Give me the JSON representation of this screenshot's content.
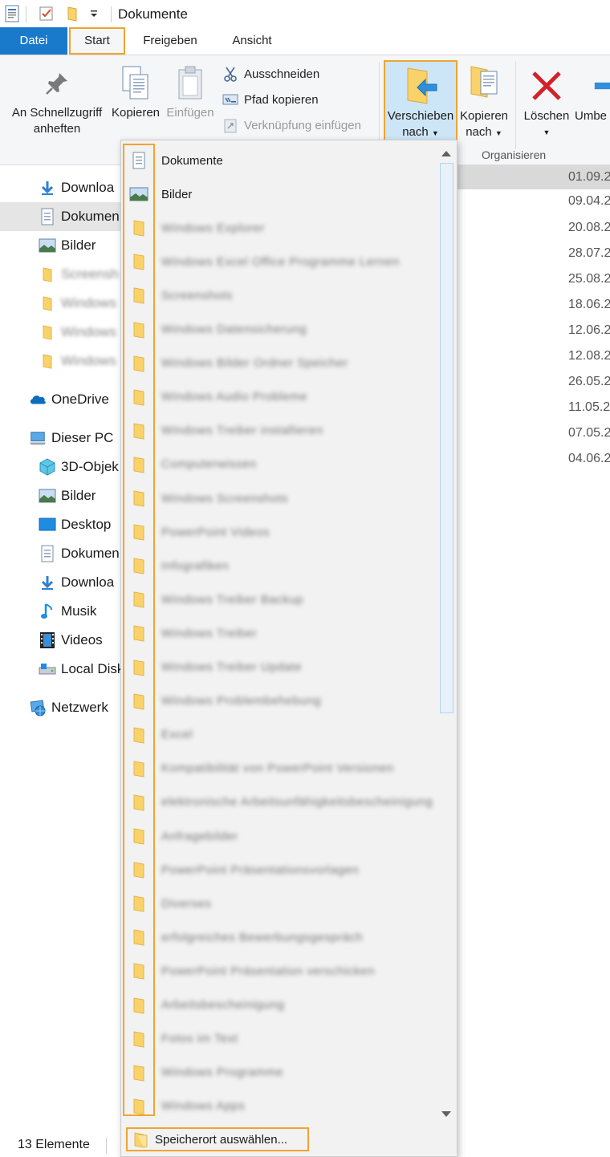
{
  "window": {
    "title": "Dokumente"
  },
  "tabs": {
    "datei": "Datei",
    "start": "Start",
    "freigeben": "Freigeben",
    "ansicht": "Ansicht"
  },
  "ribbon": {
    "pin_line1": "An Schnellzugriff",
    "pin_line2": "anheften",
    "copy": "Kopieren",
    "paste": "Einfügen",
    "cut": "Ausschneiden",
    "copy_path": "Pfad kopieren",
    "paste_shortcut": "Verknüpfung einfügen",
    "move_line1": "Verschieben",
    "move_line2": "nach",
    "copyto_line1": "Kopieren",
    "copyto_line2": "nach",
    "delete": "Löschen",
    "rename": "Umbe",
    "group_organize": "Organisieren"
  },
  "nav": {
    "items": [
      {
        "label": "Downloa"
      },
      {
        "label": "Dokumen"
      },
      {
        "label": "Bilder"
      },
      {
        "label": "Screensh"
      },
      {
        "label": "Windows"
      },
      {
        "label": "Windows"
      },
      {
        "label": "Windows"
      },
      {
        "label": "OneDrive"
      },
      {
        "label": "Dieser PC"
      },
      {
        "label": "3D-Objek"
      },
      {
        "label": "Bilder"
      },
      {
        "label": "Desktop"
      },
      {
        "label": "Dokumen"
      },
      {
        "label": "Downloa"
      },
      {
        "label": "Musik"
      },
      {
        "label": "Videos"
      },
      {
        "label": "Local Disk"
      },
      {
        "label": "Netzwerk"
      }
    ]
  },
  "content": {
    "dates": [
      "01.09.2",
      "09.04.2",
      "20.08.2",
      "28.07.2",
      "25.08.2",
      "18.06.2",
      "12.06.2",
      "12.08.2",
      "26.05.2",
      "11.05.2",
      "07.05.2",
      "04.06.2"
    ]
  },
  "dropdown": {
    "items": [
      {
        "label": "Dokumente",
        "icon": "documents-icon"
      },
      {
        "label": "Bilder",
        "icon": "pictures-icon"
      },
      {
        "label": "Windows Explorer",
        "icon": "folder-icon"
      },
      {
        "label": "Windows Excel Office Programme Lernen",
        "icon": "folder-icon"
      },
      {
        "label": "Screenshots",
        "icon": "folder-icon"
      },
      {
        "label": "Windows Datensicherung",
        "icon": "folder-icon"
      },
      {
        "label": "Windows Bilder Ordner Speicher",
        "icon": "folder-icon"
      },
      {
        "label": "Windows Audio Probleme",
        "icon": "folder-icon"
      },
      {
        "label": "Windows Treiber installieren",
        "icon": "folder-icon"
      },
      {
        "label": "Computerwissen",
        "icon": "folder-icon"
      },
      {
        "label": "Windows Screenshots",
        "icon": "folder-icon"
      },
      {
        "label": "PowerPoint Videos",
        "icon": "folder-icon"
      },
      {
        "label": "Infografiken",
        "icon": "folder-icon"
      },
      {
        "label": "Windows Treiber Backup",
        "icon": "folder-icon"
      },
      {
        "label": "Windows Treiber",
        "icon": "folder-icon"
      },
      {
        "label": "Windows Treiber Update",
        "icon": "folder-icon"
      },
      {
        "label": "Windows Problembehebung",
        "icon": "folder-icon"
      },
      {
        "label": "Excel",
        "icon": "folder-icon"
      },
      {
        "label": "Kompatibilität von PowerPoint Versionen",
        "icon": "folder-icon"
      },
      {
        "label": "elektronische Arbeitsunfähigkeitsbescheinigung",
        "icon": "folder-icon"
      },
      {
        "label": "Anfragebilder",
        "icon": "folder-icon"
      },
      {
        "label": "PowerPoint Präsentationsvorlagen",
        "icon": "folder-icon"
      },
      {
        "label": "Diverses",
        "icon": "folder-icon"
      },
      {
        "label": "erfolgreiches Bewerbungsgespräch",
        "icon": "folder-icon"
      },
      {
        "label": "PowerPoint Präsentation verschicken",
        "icon": "folder-icon"
      },
      {
        "label": "Arbeitsbescheinigung",
        "icon": "folder-icon"
      },
      {
        "label": "Fotos im Text",
        "icon": "folder-icon"
      },
      {
        "label": "Windows Programme",
        "icon": "folder-icon"
      },
      {
        "label": "Windows Apps",
        "icon": "folder-icon"
      }
    ],
    "choose_location": "Speicherort auswählen..."
  },
  "status": {
    "count": "13 Elemente"
  },
  "colors": {
    "accent": "#1979ca",
    "highlight": "#f0a431",
    "folder": "#f9d26a",
    "selected": "#cde6f7"
  }
}
